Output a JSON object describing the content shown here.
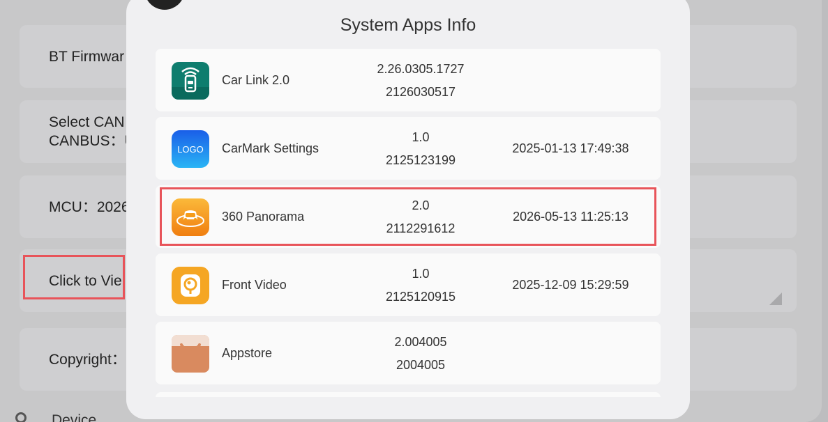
{
  "background": {
    "cards": [
      {
        "lines": [
          "BT Firmwar"
        ]
      },
      {
        "lines": [
          "Select CAN",
          "CANBUS：U"
        ]
      },
      {
        "lines": [
          "MCU：2026"
        ]
      },
      {
        "lines": [
          "Click to Vie"
        ]
      },
      {
        "lines": [
          "Copyright："
        ]
      }
    ],
    "bottom_text": "Device"
  },
  "dialog": {
    "title": "System Apps Info",
    "apps": [
      {
        "name": "Car Link 2.0",
        "version": "2.26.0305.1727",
        "code": "2126030517",
        "date": "",
        "icon": "car-link-icon",
        "icon_color": "#0e7d6e"
      },
      {
        "name": "CarMark Settings",
        "version": "1.0",
        "code": "2125123199",
        "date": "2025-01-13 17:49:38",
        "icon": "logo-icon",
        "icon_color": "#1a8cf0",
        "icon_text": "LOGO"
      },
      {
        "name": "360 Panorama",
        "version": "2.0",
        "code": "2112291612",
        "date": "2026-05-13 11:25:13",
        "icon": "panorama-car-icon",
        "icon_color": "#f59c1a"
      },
      {
        "name": "Front Video",
        "version": "1.0",
        "code": "2125120915",
        "date": "2025-12-09 15:29:59",
        "icon": "front-video-icon",
        "icon_color": "#f5a623"
      },
      {
        "name": "Appstore",
        "version": "2.004005",
        "code": "2004005",
        "date": "",
        "icon": "appstore-bag-icon",
        "icon_color": "#d98a5f"
      }
    ]
  },
  "colors": {
    "highlight": "#e8545a"
  }
}
